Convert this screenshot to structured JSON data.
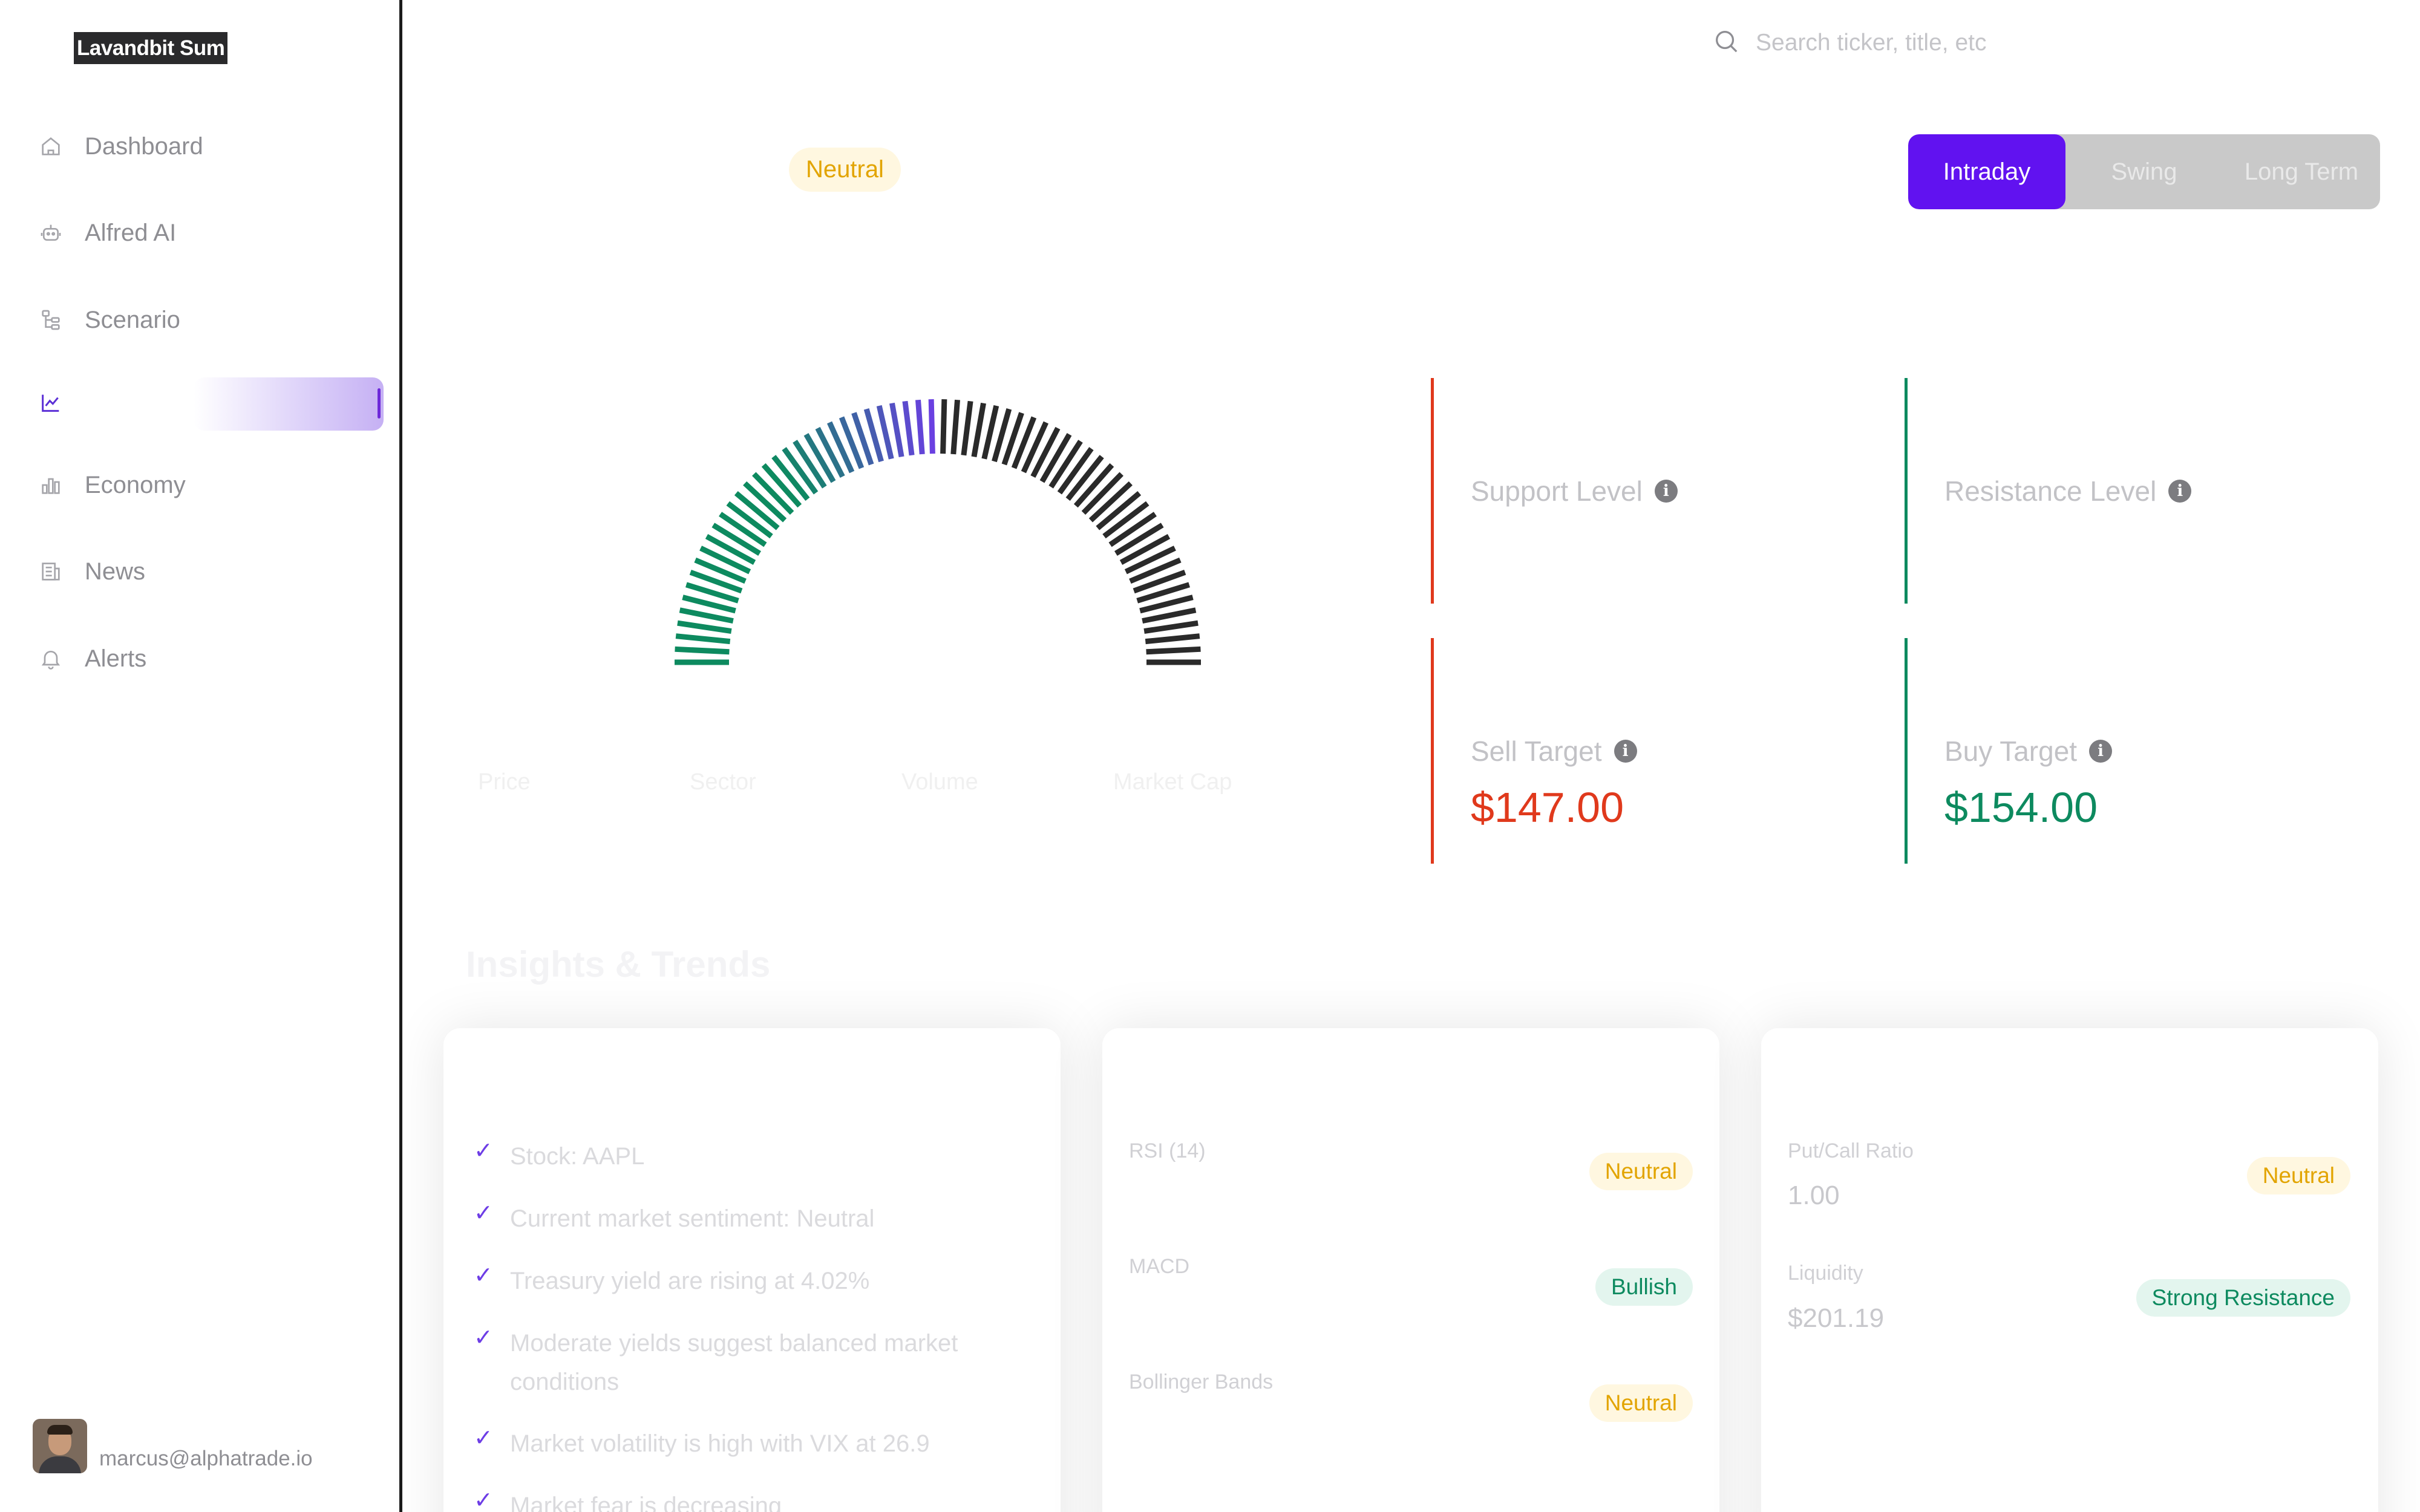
{
  "app": {
    "brand": "Lavandbit Sum"
  },
  "sidebar": {
    "items": [
      {
        "label": "Dashboard",
        "icon": "home-icon"
      },
      {
        "label": "Alfred AI",
        "icon": "robot-icon"
      },
      {
        "label": "Scenario",
        "icon": "tree-icon"
      },
      {
        "label": "",
        "icon": "chart-line-icon",
        "active": true
      },
      {
        "label": "Economy",
        "icon": "bar-chart-icon"
      },
      {
        "label": "News",
        "icon": "newspaper-icon"
      },
      {
        "label": "Alerts",
        "icon": "bell-icon"
      }
    ],
    "user_email": "marcus@alphatrade.io"
  },
  "search": {
    "placeholder": "Search ticker, title, etc"
  },
  "sentiment_badge": "Neutral",
  "timeframes": {
    "options": [
      "Intraday",
      "Swing",
      "Long Term"
    ],
    "selected": "Intraday"
  },
  "gauge": {
    "bullish_color": "#0d8a5f",
    "mid_color": "#6d3de6",
    "bearish_color": "#2a2a2a"
  },
  "faint_metrics": [
    "Price",
    "Sector",
    "Volume",
    "Market Cap"
  ],
  "levels": {
    "support": {
      "title": "Support Level",
      "value": ""
    },
    "resistance": {
      "title": "Resistance Level",
      "value": ""
    },
    "sell": {
      "title": "Sell Target",
      "value": "$147.00"
    },
    "buy": {
      "title": "Buy Target",
      "value": "$154.00"
    }
  },
  "section_title": "Insights & Trends",
  "insights": [
    "Stock: AAPL",
    "Current market sentiment: Neutral",
    "Treasury yield are rising at 4.02%",
    "Moderate yields suggest balanced market conditions",
    "Market volatility is high with VIX at 26.9",
    "Market fear is decreasing"
  ],
  "technicals": [
    {
      "label": "RSI (14)",
      "status": "Neutral"
    },
    {
      "label": "MACD",
      "status": "Bullish"
    },
    {
      "label": "Bollinger Bands",
      "status": "Neutral"
    }
  ],
  "options_flow": [
    {
      "label": "Put/Call Ratio",
      "value": "1.00",
      "status": "Neutral"
    },
    {
      "label": "Liquidity",
      "value": "$201.19",
      "status": "Strong Resistance"
    }
  ],
  "colors": {
    "accent": "#6112f0",
    "sell": "#e0391c",
    "buy": "#0d8a5f",
    "neutral": "#e2a400"
  }
}
